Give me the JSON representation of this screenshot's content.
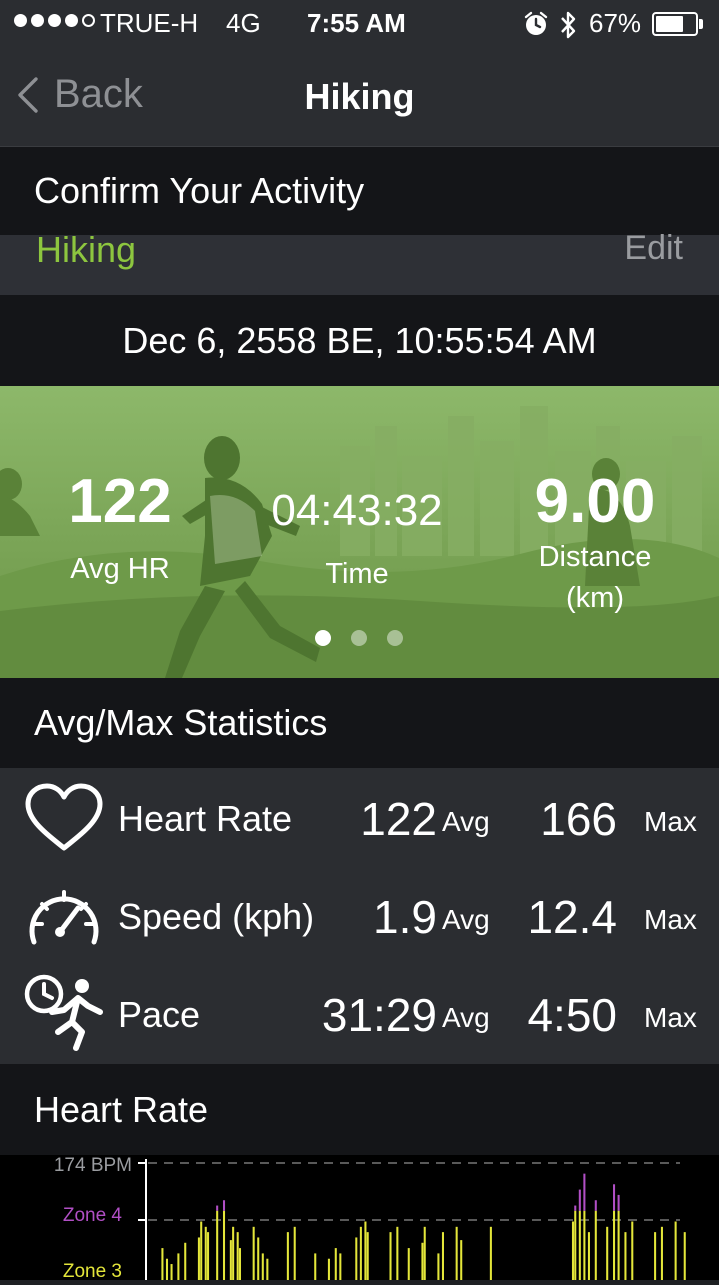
{
  "status_bar": {
    "carrier": "TRUE-H",
    "network": "4G",
    "time": "7:55 AM",
    "battery": "67%",
    "signal_bars_filled": 4,
    "signal_bars_total": 5,
    "battery_level": 0.67,
    "icons": [
      "alarm-icon",
      "bluetooth-icon",
      "battery-icon"
    ]
  },
  "nav": {
    "back_label": "Back",
    "title": "Hiking"
  },
  "confirm_header": "Confirm Your Activity",
  "activity": {
    "name": "Hiking",
    "edit_label": "Edit",
    "date": "Dec 6, 2558 BE, 10:55:54 AM"
  },
  "hero": {
    "avg_hr": {
      "value": "122",
      "label": "Avg HR"
    },
    "time": {
      "value": "04:43:32",
      "label": "Time"
    },
    "distance": {
      "value": "9.00",
      "label": "Distance",
      "unit": "(km)"
    },
    "page_count": 3,
    "active_page": 0
  },
  "stats_header": "Avg/Max Statistics",
  "stats": [
    {
      "name": "Heart Rate",
      "avg": "122",
      "avg_label": "Avg",
      "max": "166",
      "max_label": "Max",
      "icon": "heart-icon"
    },
    {
      "name": "Speed (kph)",
      "avg": "1.9",
      "avg_label": "Avg",
      "max": "12.4",
      "max_label": "Max",
      "icon": "speedometer-icon"
    },
    {
      "name": "Pace",
      "avg": "31:29",
      "avg_label": "Avg",
      "max": "4:50",
      "max_label": "Max",
      "icon": "pace-runner-icon"
    }
  ],
  "hr_header": "Heart Rate",
  "colors": {
    "accent_green": "#8dc63f",
    "zone4": "#b14fc5",
    "zone3": "#e4e63a"
  },
  "chart_data": {
    "type": "bar",
    "y_labels": [
      "174 BPM",
      "Zone 4",
      "Zone 3"
    ],
    "ylim": [
      130,
      174
    ],
    "grid": "dashed",
    "zone4_threshold": 156,
    "values": [
      0,
      0,
      0,
      0,
      0,
      142,
      0,
      138,
      0,
      136,
      0,
      0,
      140,
      0,
      0,
      144,
      0,
      0,
      0,
      0,
      0,
      146,
      152,
      0,
      150,
      148,
      0,
      0,
      0,
      158,
      0,
      0,
      160,
      0,
      0,
      145,
      150,
      0,
      148,
      142,
      0,
      0,
      0,
      0,
      0,
      150,
      0,
      146,
      0,
      140,
      0,
      138,
      0,
      0,
      0,
      0,
      0,
      0,
      0,
      0,
      148,
      0,
      0,
      150,
      0,
      0,
      0,
      0,
      0,
      0,
      0,
      0,
      140,
      0,
      0,
      0,
      0,
      0,
      138,
      0,
      0,
      142,
      0,
      140,
      0,
      0,
      0,
      0,
      0,
      0,
      146,
      0,
      150,
      0,
      152,
      148,
      0,
      0,
      0,
      0,
      0,
      0,
      0,
      0,
      0,
      148,
      0,
      0,
      150,
      0,
      0,
      0,
      0,
      142,
      0,
      0,
      0,
      0,
      0,
      144,
      150,
      0,
      0,
      0,
      0,
      0,
      140,
      0,
      148,
      0,
      0,
      0,
      0,
      0,
      150,
      0,
      145,
      0,
      0,
      0,
      0,
      0,
      0,
      0,
      0,
      0,
      0,
      0,
      0,
      150,
      0,
      0,
      0,
      0,
      0,
      0,
      0,
      0,
      0,
      0,
      0,
      0,
      0,
      0,
      0,
      0,
      0,
      0,
      0,
      0,
      0,
      0,
      0,
      0,
      0,
      0,
      0,
      0,
      0,
      0,
      0,
      0,
      0,
      0,
      0,
      152,
      158,
      0,
      164,
      0,
      170,
      0,
      148,
      0,
      0,
      160,
      0,
      0,
      0,
      0,
      150,
      0,
      0,
      166,
      0,
      162,
      0,
      0,
      148,
      0,
      0,
      152,
      0,
      0,
      0,
      0,
      0,
      0,
      0,
      0,
      0,
      148,
      0,
      0,
      150,
      0,
      0,
      0,
      0,
      0,
      152,
      0,
      0,
      0,
      148
    ]
  }
}
